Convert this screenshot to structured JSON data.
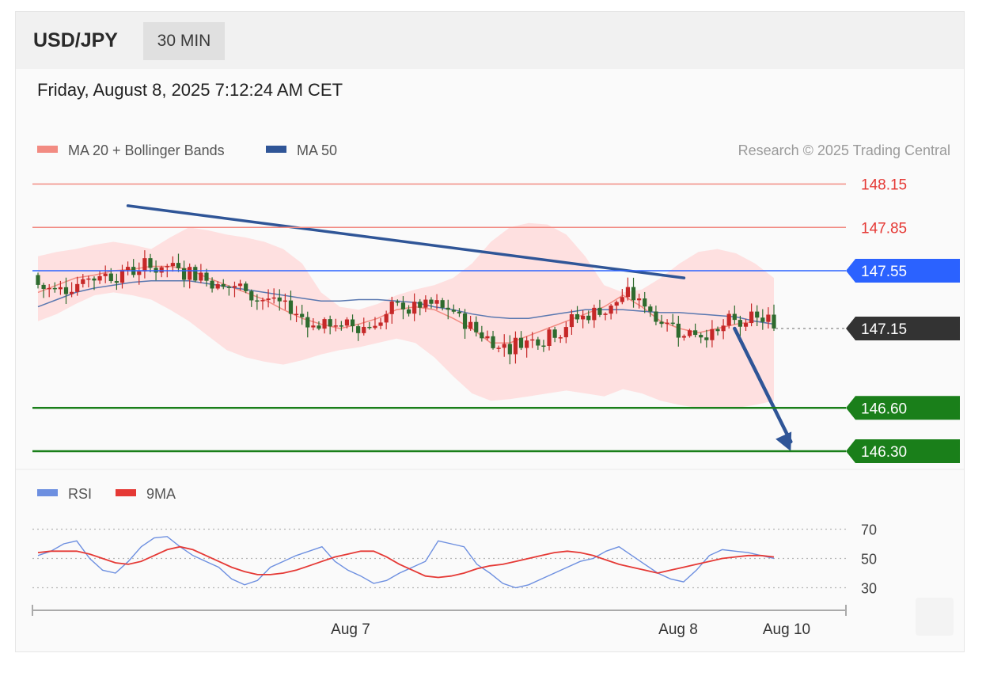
{
  "header": {
    "pair": "USD/JPY",
    "timeframe": "30 MIN",
    "datetime": "Friday, August 8, 2025 7:12:24 AM CET"
  },
  "legend": {
    "ma20_bb": "MA 20 + Bollinger Bands",
    "ma50": "MA 50",
    "credit": "Research © 2025 Trading Central"
  },
  "colors": {
    "resistance": "#f28b82",
    "resistance_text": "#e53935",
    "pivot": "#2b62ff",
    "last_price": "#333333",
    "support": "#1a7f1a",
    "bull": "#c62828",
    "bear": "#2e6b2e",
    "trendline": "#2f5597",
    "bb_fill": "#ffd7d7",
    "ma20": "#f28b82",
    "ma50": "#5a78b0",
    "rsi": "#6d8fe0",
    "rsi_ma": "#e53935"
  },
  "chart_data": [
    {
      "type": "candlestick",
      "ylim": [
        146.25,
        148.25
      ],
      "levels": [
        {
          "label": "148.15",
          "value": 148.15,
          "kind": "resistance"
        },
        {
          "label": "147.85",
          "value": 147.85,
          "kind": "resistance"
        },
        {
          "label": "147.55",
          "value": 147.55,
          "kind": "pivot"
        },
        {
          "label": "147.15",
          "value": 147.15,
          "kind": "last"
        },
        {
          "label": "146.60",
          "value": 146.6,
          "kind": "support"
        },
        {
          "label": "146.30",
          "value": 146.3,
          "kind": "support"
        }
      ],
      "x_ticks": [
        "Aug 7",
        "Aug 8",
        "Aug 10"
      ],
      "trendline": {
        "start": {
          "bar": 16,
          "price": 148.0
        },
        "end": {
          "bar": 115,
          "price": 147.5
        }
      },
      "projection": {
        "from": {
          "bar": 124,
          "price": 147.15
        },
        "to": {
          "bar": 134,
          "price": 146.3
        }
      },
      "series": [
        {
          "name": "MA 20 + Bollinger Bands",
          "upper": [
            147.65,
            147.68,
            147.7,
            147.73,
            147.75,
            147.73,
            147.7,
            147.78,
            147.85,
            147.83,
            147.8,
            147.78,
            147.75,
            147.7,
            147.6,
            147.4,
            147.3,
            147.28,
            147.32,
            147.38,
            147.42,
            147.45,
            147.5,
            147.6,
            147.75,
            147.85,
            147.88,
            147.87,
            147.8,
            147.65,
            147.45,
            147.4,
            147.42,
            147.5,
            147.6,
            147.68,
            147.7,
            147.67,
            147.6,
            147.5
          ],
          "mid": [
            147.4,
            147.45,
            147.5,
            147.52,
            147.55,
            147.56,
            147.58,
            147.58,
            147.56,
            147.5,
            147.45,
            147.4,
            147.35,
            147.28,
            147.22,
            147.18,
            147.15,
            147.18,
            147.22,
            147.28,
            147.3,
            147.28,
            147.22,
            147.15,
            147.05,
            147.05,
            147.1,
            147.15,
            147.2,
            147.25,
            147.3,
            147.38,
            147.3,
            147.2,
            147.15,
            147.12,
            147.15,
            147.18,
            147.2,
            147.18
          ],
          "lower": [
            147.2,
            147.25,
            147.32,
            147.38,
            147.4,
            147.38,
            147.35,
            147.28,
            147.2,
            147.1,
            147.0,
            146.95,
            146.92,
            146.9,
            146.93,
            146.97,
            147.0,
            147.02,
            147.05,
            147.08,
            147.05,
            146.95,
            146.82,
            146.7,
            146.65,
            146.66,
            146.68,
            146.7,
            146.72,
            146.7,
            146.68,
            146.73,
            146.7,
            146.65,
            146.62,
            146.6,
            146.6,
            146.6,
            146.62,
            146.65
          ]
        },
        {
          "name": "MA 50",
          "values": [
            147.3,
            147.35,
            147.4,
            147.43,
            147.45,
            147.47,
            147.48,
            147.48,
            147.48,
            147.46,
            147.44,
            147.42,
            147.4,
            147.38,
            147.36,
            147.34,
            147.34,
            147.35,
            147.35,
            147.34,
            147.33,
            147.3,
            147.28,
            147.25,
            147.23,
            147.22,
            147.22,
            147.24,
            147.26,
            147.28,
            147.28,
            147.28,
            147.27,
            147.26,
            147.26,
            147.25,
            147.24,
            147.23,
            147.2,
            147.18
          ]
        }
      ]
    },
    {
      "type": "line",
      "ylim": [
        20,
        80
      ],
      "y_ticks": [
        70,
        50,
        30
      ],
      "series": [
        {
          "name": "RSI",
          "values": [
            52,
            55,
            60,
            62,
            50,
            42,
            40,
            48,
            58,
            64,
            65,
            58,
            52,
            48,
            44,
            36,
            32,
            35,
            44,
            48,
            52,
            55,
            58,
            48,
            42,
            38,
            33,
            35,
            40,
            44,
            48,
            62,
            60,
            58,
            46,
            40,
            33,
            30,
            32,
            36,
            40,
            44,
            48,
            50,
            55,
            58,
            52,
            46,
            40,
            36,
            34,
            42,
            52,
            56,
            55,
            54,
            52,
            50
          ]
        },
        {
          "name": "9MA",
          "values": [
            54,
            55,
            55,
            55,
            53,
            50,
            47,
            46,
            48,
            52,
            56,
            58,
            56,
            52,
            48,
            44,
            41,
            39,
            39,
            40,
            42,
            45,
            48,
            51,
            53,
            55,
            55,
            51,
            46,
            42,
            38,
            37,
            38,
            40,
            43,
            45,
            46,
            48,
            50,
            52,
            54,
            55,
            54,
            52,
            49,
            46,
            44,
            42,
            40,
            42,
            44,
            46,
            48,
            50,
            51,
            52,
            52,
            51
          ]
        }
      ]
    }
  ],
  "rsi_legend": {
    "rsi": "RSI",
    "ma": "9MA"
  }
}
